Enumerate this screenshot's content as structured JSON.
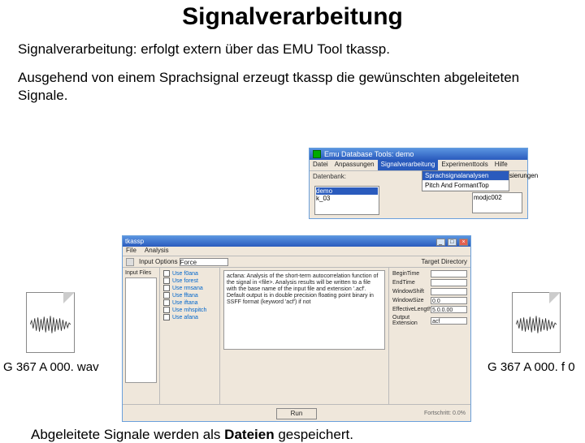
{
  "title": "Signalverarbeitung",
  "para1": "Signalverarbeitung: erfolgt extern über das EMU Tool tkassp.",
  "para2": "Ausgehend von einem Sprachsignal erzeugt tkassp die gewünschten abgeleiteten Signale.",
  "para3_prefix": "Abgeleitete Signale werden als ",
  "para3_bold": "Dateien",
  "para3_suffix": " gespeichert.",
  "file_left": "G 367 A 000. wav",
  "file_right": "G 367 A 000. f 0",
  "emu": {
    "title": "Emu Database Tools: demo",
    "menu": [
      "Datei",
      "Anpassungen",
      "Signalverarbeitung",
      "Experimenttools",
      "Hilfe"
    ],
    "db_label": "Datenbank:",
    "submenu": [
      "Sprachsignalanalysen",
      "Pitch And FormantTop"
    ],
    "submenu_trail": "sierungen",
    "list": [
      "demo",
      "k_03"
    ],
    "list2": "modjc002"
  },
  "tk": {
    "title": "tkassp",
    "menu": [
      "File",
      "Analysis"
    ],
    "tool_label": "Input Options",
    "tool_mode": "Force",
    "target_label": "Target Directory",
    "col1_label": "Input Files",
    "analyses": [
      "Use f0ana",
      "Use forest",
      "Use rmsana",
      "Use fftana",
      "Use iftana",
      "Use mhspitch",
      "Use afana"
    ],
    "desc": "acfana:\nAnalysis of the short-term autocorrelation function of the signal in <file>.\nAnalysis results will be written to a file with the base name of the input file and extension '.acf'.\nDefault output is in double precision floating point binary in SSFF format (keyword 'acf') if not",
    "params": [
      {
        "label": "BeginTime",
        "val": ""
      },
      {
        "label": "EndTime",
        "val": ""
      },
      {
        "label": "WindowShift",
        "val": ""
      },
      {
        "label": "WindowSize",
        "val": "0.0"
      },
      {
        "label": "EffectiveLength",
        "val": "5.0.0.00"
      },
      {
        "label": "Output Extension",
        "val": "acf"
      }
    ],
    "run_btn": "Run",
    "page_info": "Fortschritt: 0.0%"
  }
}
